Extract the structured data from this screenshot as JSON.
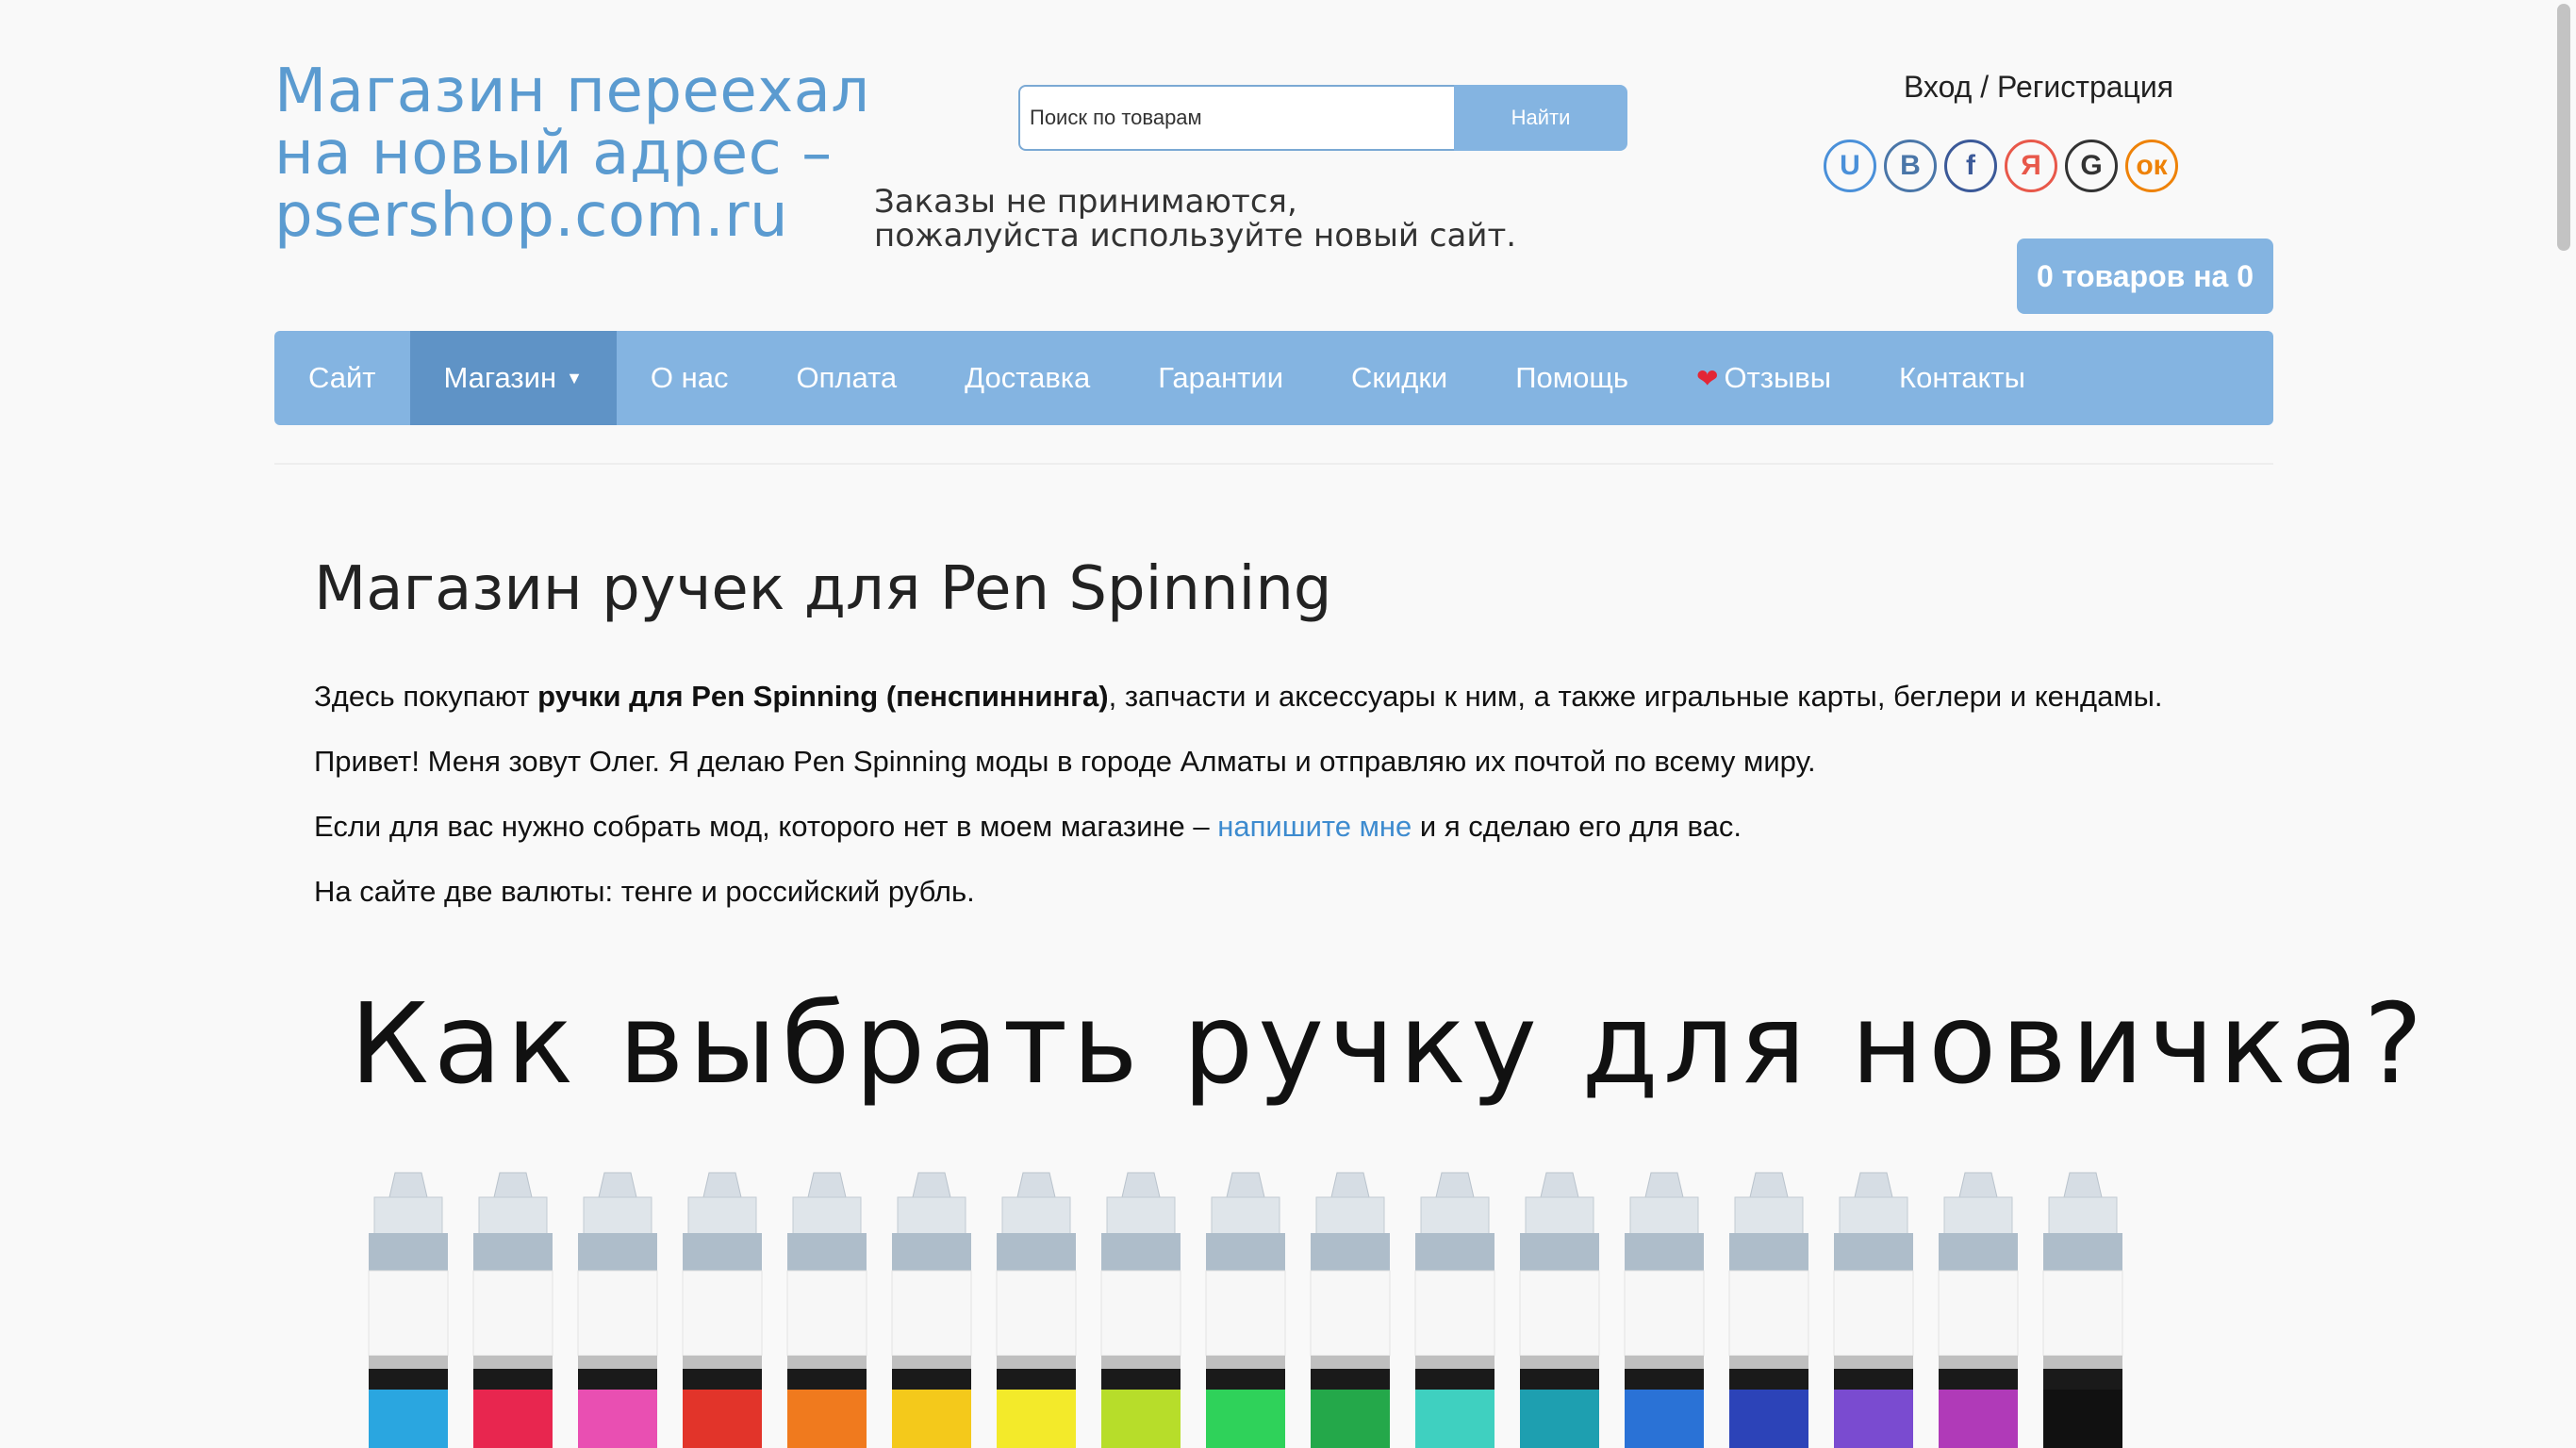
{
  "header": {
    "site_title": "Магазин переехал на новый адрес – psershop.com.ru",
    "notice_line1": "Заказы не принимаются,",
    "notice_line2": "пожалуйста используйте новый сайт.",
    "search_placeholder": "Поиск по товарам",
    "search_button": "Найти",
    "login_link": "Вход / Регистрация",
    "social": [
      {
        "label": "U",
        "color": "#4a90d9",
        "icon": "uid-icon"
      },
      {
        "label": "B",
        "color": "#4a76a8",
        "icon": "vk-icon"
      },
      {
        "label": "f",
        "color": "#3b5998",
        "icon": "facebook-icon"
      },
      {
        "label": "Я",
        "color": "#e8584a",
        "icon": "yandex-icon"
      },
      {
        "label": "G",
        "color": "#333333",
        "icon": "google-icon"
      },
      {
        "label": "ок",
        "color": "#ee8208",
        "icon": "odnoklassniki-icon"
      }
    ],
    "cart": "0 товаров на 0"
  },
  "nav": [
    {
      "label": "Сайт"
    },
    {
      "label": "Магазин"
    },
    {
      "label": "О нас"
    },
    {
      "label": "Оплата"
    },
    {
      "label": "Доставка"
    },
    {
      "label": "Гарантии"
    },
    {
      "label": "Скидки"
    },
    {
      "label": "Помощь"
    },
    {
      "label": "Отзывы"
    },
    {
      "label": "Контакты"
    }
  ],
  "main": {
    "title": "Магазин ручек для Pen Spinning",
    "p1_before": "Здесь покупают ",
    "p1_bold": "ручки для Pen Spinning (пенспиннинга)",
    "p1_after": ", запчасти и аксессуары к ним, а также игральные карты, беглери и кендамы.",
    "p2": "Привет! Меня зовут Олег. Я делаю Pen Spinning моды в городе Алматы и отправляю их почтой по всему миру.",
    "p3_before": "Если для вас нужно собрать мод, которого нет в моем магазине – ",
    "p3_link": "напишите мне",
    "p3_after": " и я сделаю его для вас.",
    "p4": "На сайте две валюты: тенге и российский рубль.",
    "banner_title": "Как выбрать ручку для новичка?"
  },
  "banner_pens": {
    "colors": [
      "#2aa6e0",
      "#e8264f",
      "#e94fb2",
      "#e2342a",
      "#f07a1e",
      "#f4c91b",
      "#f3ea2a",
      "#b7dd2a",
      "#2fd25a",
      "#24a84a",
      "#3fd0c0",
      "#1e9fb0",
      "#2a72d6",
      "#2c43b8",
      "#7a4bd0",
      "#b03ab8",
      "#111111"
    ]
  }
}
